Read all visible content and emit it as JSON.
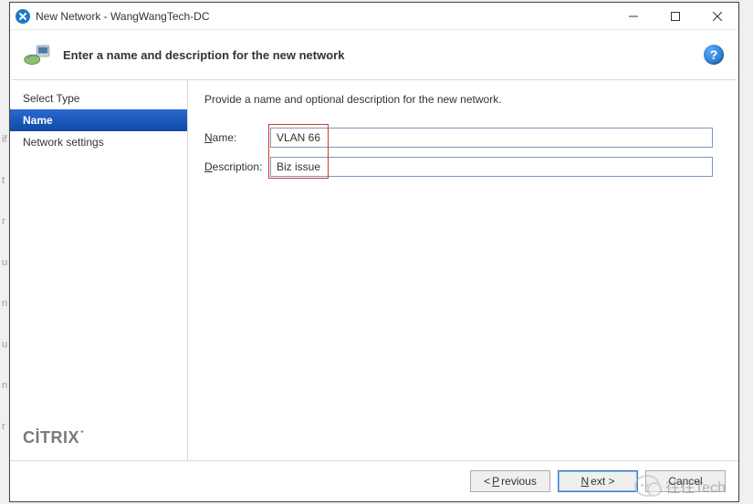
{
  "window": {
    "title": "New Network - WangWangTech-DC"
  },
  "header": {
    "heading": "Enter a name and description for the new network"
  },
  "sidebar": {
    "steps": [
      {
        "label": "Select Type",
        "active": false
      },
      {
        "label": "Name",
        "active": true
      },
      {
        "label": "Network settings",
        "active": false
      }
    ],
    "brand": "CİTRIX"
  },
  "content": {
    "instruction": "Provide a name and optional description for the new network.",
    "name_label_prefix": "N",
    "name_label_rest": "ame:",
    "name_value": "VLAN 66",
    "desc_label_prefix": "D",
    "desc_label_rest": "escription:",
    "desc_value": "Biz issue"
  },
  "footer": {
    "previous_pre": "< ",
    "previous_u": "P",
    "previous_post": "revious",
    "next_u": "N",
    "next_post": "ext >",
    "cancel": "Cancel"
  },
  "watermark_text": "往往Tech"
}
